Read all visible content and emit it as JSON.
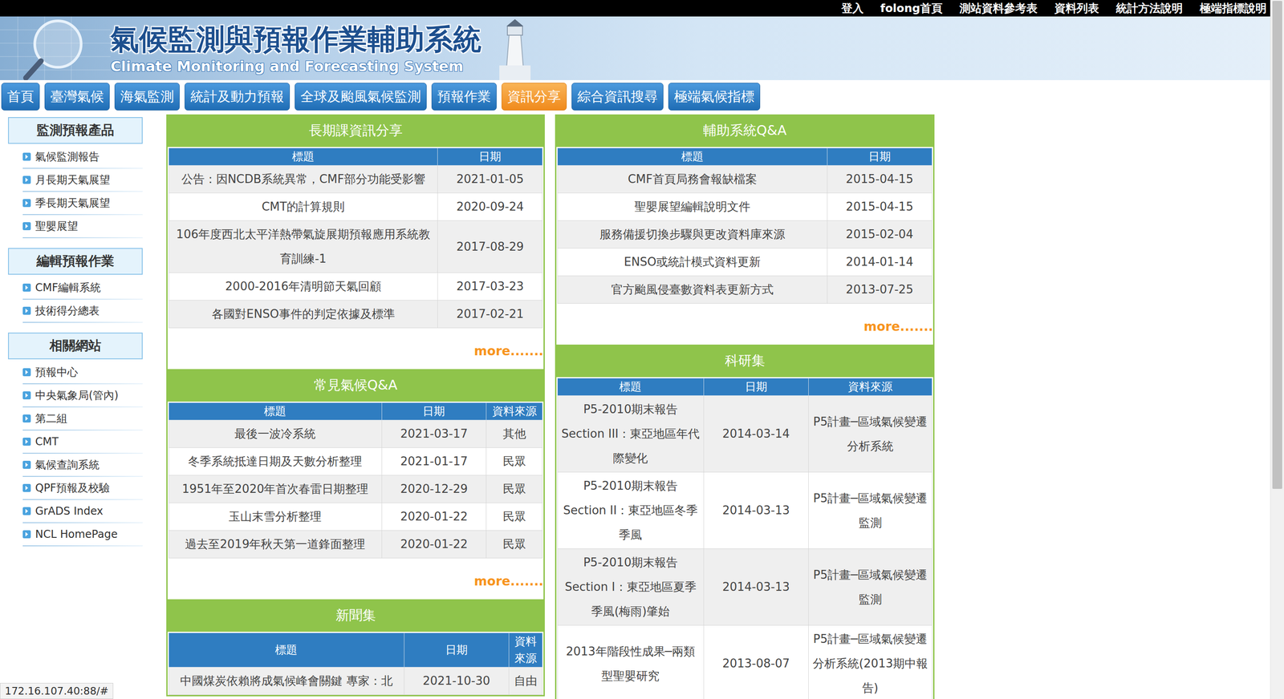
{
  "top_links": [
    "登入",
    "folong首頁",
    "測站資料參考表",
    "資料列表",
    "統計方法說明",
    "極端指標說明"
  ],
  "header": {
    "title": "氣候監測與預報作業輔助系統",
    "subtitle": "Climate Monitoring and Forecasting System"
  },
  "nav": [
    {
      "label": "首頁",
      "selected": false
    },
    {
      "label": "臺灣氣候",
      "selected": false
    },
    {
      "label": "海氣監測",
      "selected": false
    },
    {
      "label": "統計及動力預報",
      "selected": false
    },
    {
      "label": "全球及颱風氣候監測",
      "selected": false
    },
    {
      "label": "預報作業",
      "selected": false
    },
    {
      "label": "資訊分享",
      "selected": true
    },
    {
      "label": "綜合資訊搜尋",
      "selected": false
    },
    {
      "label": "極端氣候指標",
      "selected": false
    }
  ],
  "sidebar": [
    {
      "title": "監測預報產品",
      "items": [
        "氣候監測報告",
        "月長期天氣展望",
        "季長期天氣展望",
        "聖嬰展望"
      ]
    },
    {
      "title": "編輯預報作業",
      "items": [
        "CMF編輯系統",
        "技術得分總表"
      ]
    },
    {
      "title": "相關網站",
      "items": [
        "預報中心",
        "中央氣象局(管內)",
        "第二組",
        "CMT",
        "氣候查詢系統",
        "QPF預報及校驗",
        "GrADS Index",
        "NCL HomePage"
      ]
    }
  ],
  "panels_left": [
    {
      "title": "長期課資訊分享",
      "columns": [
        "標題",
        "日期"
      ],
      "rows": [
        [
          "公告：因NCDB系統異常，CMF部分功能受影響",
          "2021-01-05"
        ],
        [
          "CMT的計算規則",
          "2020-09-24"
        ],
        [
          "106年度西北太平洋熱帶氣旋展期預報應用系統教育訓練-1",
          "2017-08-29"
        ],
        [
          "2000-2016年清明節天氣回顧",
          "2017-03-23"
        ],
        [
          "各國對ENSO事件的判定依據及標準",
          "2017-02-21"
        ]
      ],
      "more": "more......."
    },
    {
      "title": "常見氣候Q&A",
      "columns": [
        "標題",
        "日期",
        "資料來源"
      ],
      "rows": [
        [
          "最後一波冷系統",
          "2021-03-17",
          "其他"
        ],
        [
          "冬季系統抵達日期及天數分析整理",
          "2021-01-17",
          "民眾"
        ],
        [
          "1951年至2020年首次春雷日期整理",
          "2020-12-29",
          "民眾"
        ],
        [
          "玉山末雪分析整理",
          "2020-01-22",
          "民眾"
        ],
        [
          "過去至2019年秋天第一道鋒面整理",
          "2020-01-22",
          "民眾"
        ]
      ],
      "more": "more......."
    },
    {
      "title": "新聞集",
      "columns": [
        "標題",
        "日期",
        "資料來源"
      ],
      "rows": [
        [
          "中國煤炭依賴將成氣候峰會關鍵 專家：北",
          "2021-10-30",
          "自由"
        ]
      ],
      "more": ""
    }
  ],
  "panels_right": [
    {
      "title": "輔助系統Q&A",
      "columns": [
        "標題",
        "日期"
      ],
      "rows": [
        [
          "CMF首頁局務會報缺檔案",
          "2015-04-15"
        ],
        [
          "聖嬰展望編輯說明文件",
          "2015-04-15"
        ],
        [
          "服務備援切換步驟與更改資料庫來源",
          "2015-02-04"
        ],
        [
          "ENSO或統計模式資料更新",
          "2014-01-14"
        ],
        [
          "官方颱風侵臺數資料表更新方式",
          "2013-07-25"
        ]
      ],
      "more": "more......."
    },
    {
      "title": "科研集",
      "columns": [
        "標題",
        "日期",
        "資料來源"
      ],
      "rows": [
        [
          "P5-2010期末報告 Section III：東亞地區年代際變化",
          "2014-03-14",
          "P5計畫─區域氣候變遷分析系統"
        ],
        [
          "P5-2010期末報告 Section II：東亞地區冬季季風",
          "2014-03-13",
          "P5計畫─區域氣候變遷監測"
        ],
        [
          "P5-2010期末報告 Section I：東亞地區夏季季風(梅雨)肇始",
          "2014-03-13",
          "P5計畫─區域氣候變遷監測"
        ],
        [
          "2013年階段性成果─兩類型聖嬰研究",
          "2013-08-07",
          "P5計畫─區域氣候變遷分析系統(2013期中報告)"
        ]
      ],
      "more": ""
    }
  ],
  "status_bar": "172.16.107.40:88/#",
  "scrollbar": {
    "level": 0.7
  }
}
